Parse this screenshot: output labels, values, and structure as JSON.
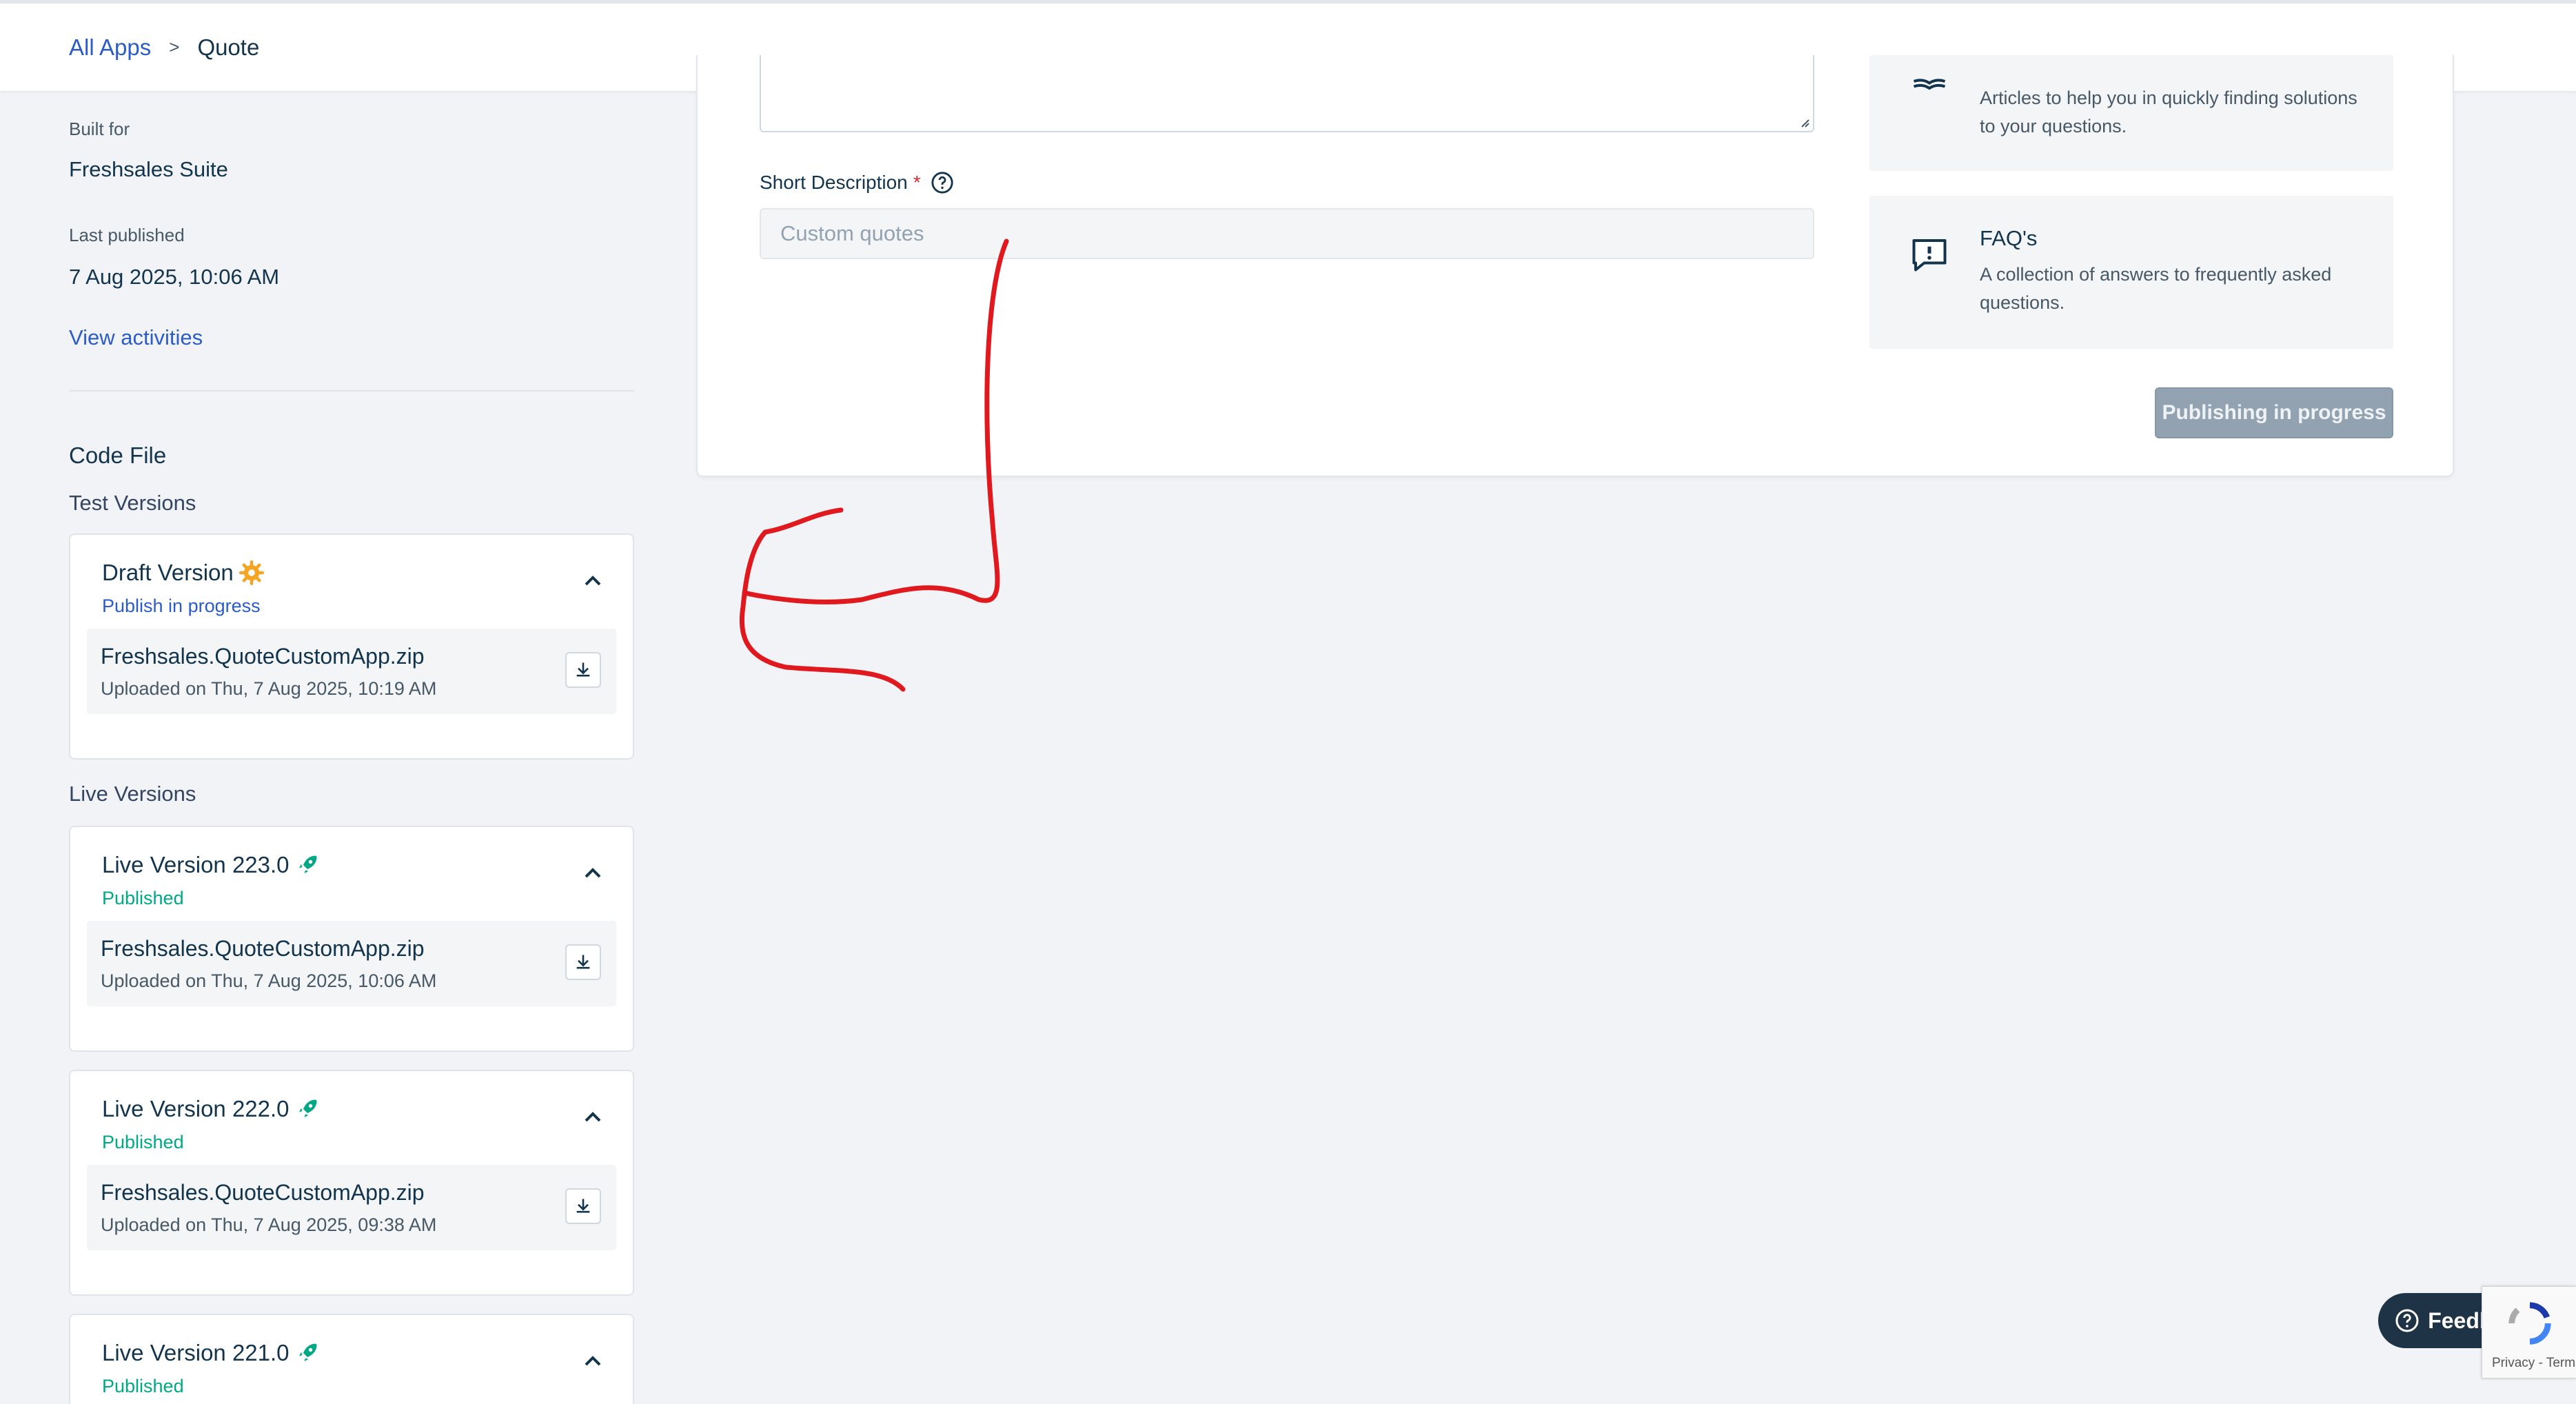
{
  "breadcrumb": {
    "root": "All Apps",
    "separator": ">",
    "current": "Quote"
  },
  "sidebar": {
    "built_for_label": "Built for",
    "built_for_value": "Freshsales Suite",
    "last_published_label": "Last published",
    "last_published_value": "7 Aug 2025, 10:06 AM",
    "view_activities": "View activities",
    "code_file_title": "Code File",
    "test_versions_title": "Test Versions",
    "live_versions_title": "Live Versions",
    "versions": [
      {
        "title": "Draft Version",
        "status": "Publish in progress",
        "icon": "gear-icon",
        "file": "Freshsales.QuoteCustomApp.zip",
        "uploaded": "Uploaded on Thu, 7 Aug 2025, 10:19 AM"
      },
      {
        "title": "Live Version 223.0",
        "status": "Published",
        "icon": "rocket-icon",
        "file": "Freshsales.QuoteCustomApp.zip",
        "uploaded": "Uploaded on Thu, 7 Aug 2025, 10:06 AM"
      },
      {
        "title": "Live Version 222.0",
        "status": "Published",
        "icon": "rocket-icon",
        "file": "Freshsales.QuoteCustomApp.zip",
        "uploaded": "Uploaded on Thu, 7 Aug 2025, 09:38 AM"
      },
      {
        "title": "Live Version 221.0",
        "status": "Published",
        "icon": "rocket-icon"
      }
    ]
  },
  "form": {
    "short_description_label": "Short Description",
    "required_mark": "*",
    "short_description_placeholder": "Custom quotes"
  },
  "help": {
    "articles_text": "Articles to help you in quickly finding solutions to your questions.",
    "faq_title": "FAQ's",
    "faq_text": "A collection of answers to frequently asked questions."
  },
  "publish_button": "Publishing in progress",
  "feedback_button": "Feedback",
  "recaptcha_text": "Privacy - Terms",
  "colors": {
    "link": "#2c5cc5",
    "published": "#00a886",
    "annotation": "#e0191f",
    "disabled_button": "#92a2b1"
  }
}
